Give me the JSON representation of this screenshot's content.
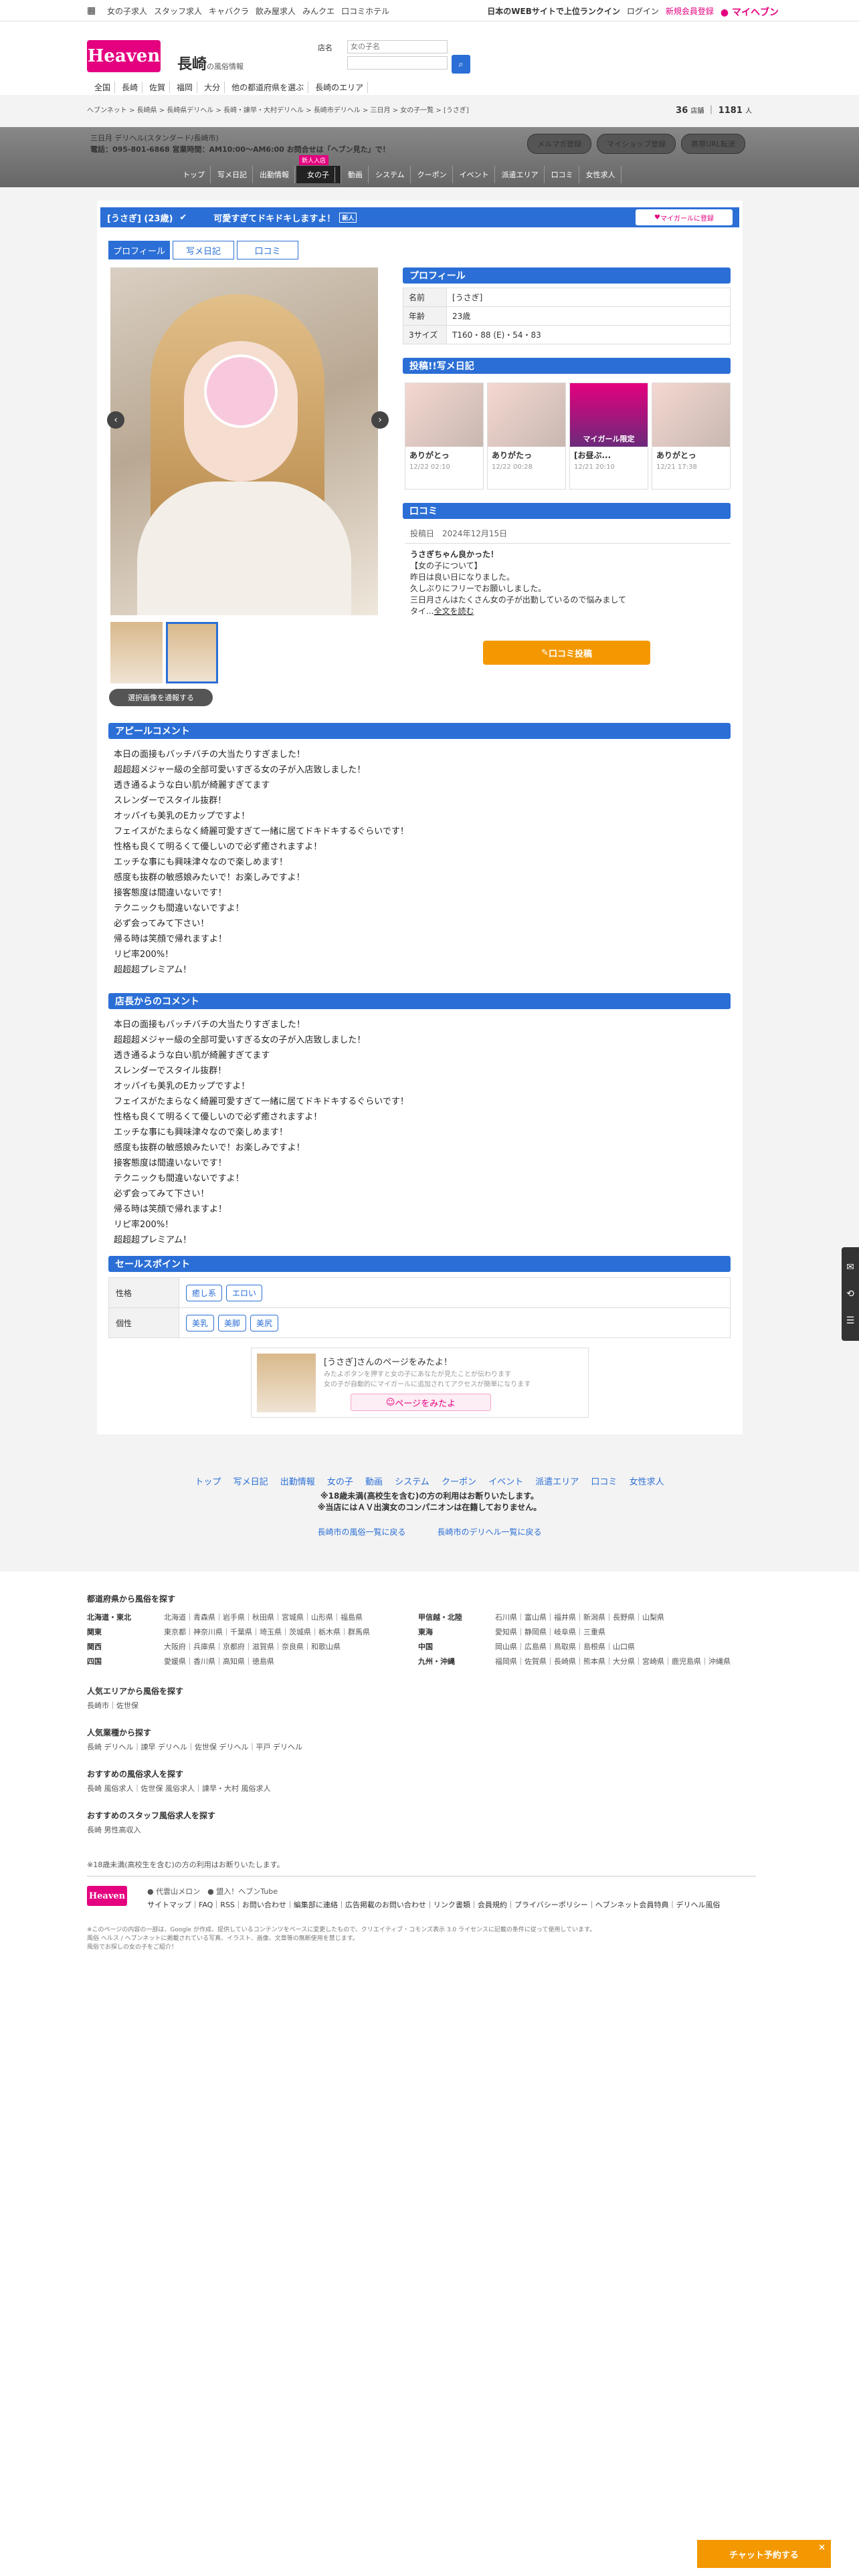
{
  "topbar": {
    "links": [
      "女の子求人",
      "スタッフ求人",
      "キャバクラ",
      "飲み屋求人",
      "みんクエ",
      "口コミホテル"
    ],
    "right_text": "日本のWEBサイトで上位ランクイン",
    "login": "ログイン",
    "register": "新規会員登録",
    "myheaven": "マイヘブン"
  },
  "header": {
    "logo": "Heaven",
    "region": "長崎",
    "region_sub": "の風俗情報",
    "search_label1": "店名",
    "search_placeholder": "女の子名",
    "nav": [
      "全国",
      "長崎",
      "佐賀",
      "福岡",
      "大分",
      "他の都道府県を選ぶ",
      "長崎のエリア"
    ]
  },
  "breadcrumb": "ヘブンネット > 長崎県 > 長崎県デリヘル > 長崎・諫早・大村デリヘル > 長崎市デリヘル > 三日月 > 女の子一覧 > [うさぎ]",
  "counts": {
    "today": "36",
    "today_label": "店舗",
    "girls": "1181",
    "girls_label": "人"
  },
  "shop": {
    "name": "三日月 デリヘル(スタンダード/長崎市)",
    "tel": "電話：095-801-6868 営業時間：AM10:00〜AM6:00 お問合せは「ヘブン見た」で！",
    "buttons": [
      "メルマガ登録",
      "マイショップ登録",
      "携帯URL転送"
    ],
    "tabs": [
      "トップ",
      "写メ日記",
      "出勤情報",
      "女の子",
      "動画",
      "システム",
      "クーポン",
      "イベント",
      "派遣エリア",
      "口コミ",
      "女性求人"
    ],
    "new_badge": "新人入店"
  },
  "girl": {
    "title": "[うさぎ] (23歳)",
    "catch": "可愛すぎてドキドキしますよ！",
    "new": "新人",
    "mygirl": "マイガールに登録",
    "tabs": [
      "プロフィール",
      "写メ日記",
      "口コミ"
    ],
    "photo_button": "選択画像を通報する"
  },
  "profile": {
    "heading": "プロフィール",
    "rows": [
      {
        "k": "名前",
        "v": "[うさぎ]"
      },
      {
        "k": "年齢",
        "v": "23歳"
      },
      {
        "k": "3サイズ",
        "v": "T160・88 (E)・54・83"
      }
    ]
  },
  "diary": {
    "heading": "投稿!!写メ日記",
    "items": [
      {
        "t": "ありがとっ",
        "d": "12/22 02:10"
      },
      {
        "t": "ありがたっ",
        "d": "12/22 00:28"
      },
      {
        "t": "[お昼ぶ...",
        "d": "12/21 20:10",
        "badge": "マイガール限定"
      },
      {
        "t": "ありがとっ",
        "d": "12/21 17:38"
      }
    ]
  },
  "review": {
    "heading": "口コミ",
    "date_label": "投稿日",
    "date": "2024年12月15日",
    "title": "うさぎちゃん良かった！",
    "body": [
      "【女の子について】",
      "昨日は良い日になりました。",
      "久しぶりにフリーでお願いしました。",
      "三日月さんはたくさん女の子が出勤しているので悩みまして",
      "タイ..."
    ],
    "more": "全文を読む",
    "button": "口コミ投稿"
  },
  "appeal": {
    "heading": "アピールコメント",
    "lines": [
      "本日の面接もバッチバチの大当たりすぎました！",
      "超超超メジャー級の全部可愛いすぎる女の子が入店致しました！",
      "透き通るような白い肌が綺麗すぎてます",
      "スレンダーでスタイル抜群！",
      "オッパイも美乳のEカップですよ！",
      "フェイスがたまらなく綺麗可愛すぎて一緒に居てドキドキするぐらいです！",
      "性格も良くて明るくて優しいので必ず癒されますよ！",
      "エッチな事にも興味津々なので楽しめます！",
      "感度も抜群の敏感娘みたいで！お楽しみですよ！",
      "接客態度は間違いないです！",
      "テクニックも間違いないですよ！",
      "必ず会ってみて下さい！",
      "帰る時は笑顔で帰れますよ！",
      "リピ率200%！",
      "超超超プレミアム！"
    ]
  },
  "manager": {
    "heading": "店長からのコメント",
    "lines": [
      "本日の面接もバッチバチの大当たりすぎました！",
      "超超超メジャー級の全部可愛いすぎる女の子が入店致しました！",
      "透き通るような白い肌が綺麗すぎてます",
      "スレンダーでスタイル抜群！",
      "オッパイも美乳のEカップですよ！",
      "フェイスがたまらなく綺麗可愛すぎて一緒に居てドキドキするぐらいです！",
      "性格も良くて明るくて優しいので必ず癒されますよ！",
      "エッチな事にも興味津々なので楽しめます！",
      "感度も抜群の敏感娘みたいで！お楽しみですよ！",
      "接客態度は間違いないです！",
      "テクニックも間違いないですよ！",
      "必ず会ってみて下さい！",
      "帰る時は笑顔で帰れますよ！",
      "リピ率200%！",
      "超超超プレミアム！"
    ]
  },
  "sales": {
    "heading": "セールスポイント",
    "rows": [
      {
        "k": "性格",
        "tags": [
          "癒し系",
          "エロい"
        ]
      },
      {
        "k": "個性",
        "tags": [
          "美乳",
          "美脚",
          "美尻"
        ]
      }
    ]
  },
  "mypage": {
    "title": "[うさぎ]さんのページをみたよ！",
    "desc1": "みたよボタンを押すと女の子にあなたが見たことが伝わります",
    "desc2": "女の子が自動的にマイガールに追加されてアクセスが簡単になります",
    "button": "ページをみたよ"
  },
  "footnav": {
    "links": [
      "トップ",
      "写メ日記",
      "出勤情報",
      "女の子",
      "動画",
      "システム",
      "クーポン",
      "イベント",
      "派遣エリア",
      "口コミ",
      "女性求人"
    ],
    "note1": "※18歳未満(高校生を含む)の方の利用はお断りいたします。",
    "note2": "※当店にはＡＶ出演女のコンパニオンは在籍しておりません。",
    "back1": "長崎市の風俗一覧に戻る",
    "back2": "長崎市のデリヘル一覧に戻る"
  },
  "site": {
    "pref_heading": "都道府県から風俗を探す",
    "regions": [
      {
        "n": "北海道・東北",
        "p": "北海道｜青森県｜岩手県｜秋田県｜宮城県｜山形県｜福島県"
      },
      {
        "n": "関東",
        "p": "東京都｜神奈川県｜千葉県｜埼玉県｜茨城県｜栃木県｜群馬県"
      },
      {
        "n": "関西",
        "p": "大阪府｜兵庫県｜京都府｜滋賀県｜奈良県｜和歌山県"
      },
      {
        "n": "四国",
        "p": "愛媛県｜香川県｜高知県｜徳島県"
      },
      {
        "n": "甲信越・北陸",
        "p": "石川県｜富山県｜福井県｜新潟県｜長野県｜山梨県"
      },
      {
        "n": "東海",
        "p": "愛知県｜静岡県｜岐阜県｜三重県"
      },
      {
        "n": "中国",
        "p": "岡山県｜広島県｜鳥取県｜島根県｜山口県"
      },
      {
        "n": "九州・沖縄",
        "p": "福岡県｜佐賀県｜長崎県｜熊本県｜大分県｜宮崎県｜鹿児島県｜沖縄県"
      }
    ],
    "pop_heading": "人気エリアから風俗を探す",
    "pop": "長崎市｜佐世保",
    "cat_heading": "人気業種から探す",
    "cat": "長崎 デリヘル｜諫早 デリヘル｜佐世保 デリヘル｜平戸 デリヘル",
    "rec_heading": "おすすめの風俗求人を探す",
    "rec": "長崎 風俗求人｜佐世保 風俗求人｜諫早・大村 風俗求人",
    "staff_heading": "おすすめのスタッフ風俗求人を探す",
    "staff": "長崎 男性高収入",
    "note": "※18歳未満(高校生を含む)の方の利用はお断りいたします。",
    "sponsors": [
      "代雲山メロン",
      "盟入！ヘブンTube"
    ],
    "links": "サイトマップ｜FAQ｜RSS｜お問い合わせ｜編集部に連絡｜広告掲載のお問い合わせ｜リンク書類｜会員規約｜プライバシーポリシー｜ヘブンネット会員特典｜デリヘル風俗",
    "copy1": "※このページの内容の一部は、Google が作成、提供しているコンテンツをベースに変更したもので、クリエイティブ・コモンズ表示 3.0 ライセンスに記載の条件に従って使用しています。",
    "copy2": "風俗 ヘルス / ヘブンネットに掲載されている写真、イラスト、画像、文章等の無断使用を禁じます。",
    "copy3": "風俗でお探しの女の子をご紹介！"
  },
  "chat": "チャット予約する"
}
